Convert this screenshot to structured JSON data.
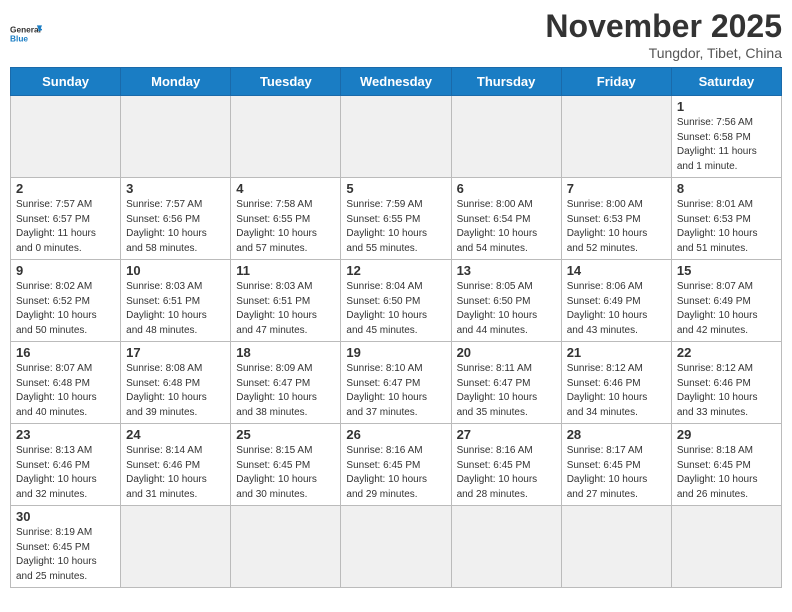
{
  "header": {
    "logo_general": "General",
    "logo_blue": "Blue",
    "month_year": "November 2025",
    "location": "Tungdor, Tibet, China"
  },
  "days_of_week": [
    "Sunday",
    "Monday",
    "Tuesday",
    "Wednesday",
    "Thursday",
    "Friday",
    "Saturday"
  ],
  "weeks": [
    {
      "days": [
        {
          "number": "",
          "empty": true
        },
        {
          "number": "",
          "empty": true
        },
        {
          "number": "",
          "empty": true
        },
        {
          "number": "",
          "empty": true
        },
        {
          "number": "",
          "empty": true
        },
        {
          "number": "",
          "empty": true
        },
        {
          "number": "1",
          "sunrise": "Sunrise: 7:56 AM",
          "sunset": "Sunset: 6:58 PM",
          "daylight": "Daylight: 11 hours and 1 minute."
        }
      ]
    },
    {
      "days": [
        {
          "number": "2",
          "sunrise": "Sunrise: 7:57 AM",
          "sunset": "Sunset: 6:57 PM",
          "daylight": "Daylight: 11 hours and 0 minutes."
        },
        {
          "number": "3",
          "sunrise": "Sunrise: 7:57 AM",
          "sunset": "Sunset: 6:56 PM",
          "daylight": "Daylight: 10 hours and 58 minutes."
        },
        {
          "number": "4",
          "sunrise": "Sunrise: 7:58 AM",
          "sunset": "Sunset: 6:55 PM",
          "daylight": "Daylight: 10 hours and 57 minutes."
        },
        {
          "number": "5",
          "sunrise": "Sunrise: 7:59 AM",
          "sunset": "Sunset: 6:55 PM",
          "daylight": "Daylight: 10 hours and 55 minutes."
        },
        {
          "number": "6",
          "sunrise": "Sunrise: 8:00 AM",
          "sunset": "Sunset: 6:54 PM",
          "daylight": "Daylight: 10 hours and 54 minutes."
        },
        {
          "number": "7",
          "sunrise": "Sunrise: 8:00 AM",
          "sunset": "Sunset: 6:53 PM",
          "daylight": "Daylight: 10 hours and 52 minutes."
        },
        {
          "number": "8",
          "sunrise": "Sunrise: 8:01 AM",
          "sunset": "Sunset: 6:53 PM",
          "daylight": "Daylight: 10 hours and 51 minutes."
        }
      ]
    },
    {
      "days": [
        {
          "number": "9",
          "sunrise": "Sunrise: 8:02 AM",
          "sunset": "Sunset: 6:52 PM",
          "daylight": "Daylight: 10 hours and 50 minutes."
        },
        {
          "number": "10",
          "sunrise": "Sunrise: 8:03 AM",
          "sunset": "Sunset: 6:51 PM",
          "daylight": "Daylight: 10 hours and 48 minutes."
        },
        {
          "number": "11",
          "sunrise": "Sunrise: 8:03 AM",
          "sunset": "Sunset: 6:51 PM",
          "daylight": "Daylight: 10 hours and 47 minutes."
        },
        {
          "number": "12",
          "sunrise": "Sunrise: 8:04 AM",
          "sunset": "Sunset: 6:50 PM",
          "daylight": "Daylight: 10 hours and 45 minutes."
        },
        {
          "number": "13",
          "sunrise": "Sunrise: 8:05 AM",
          "sunset": "Sunset: 6:50 PM",
          "daylight": "Daylight: 10 hours and 44 minutes."
        },
        {
          "number": "14",
          "sunrise": "Sunrise: 8:06 AM",
          "sunset": "Sunset: 6:49 PM",
          "daylight": "Daylight: 10 hours and 43 minutes."
        },
        {
          "number": "15",
          "sunrise": "Sunrise: 8:07 AM",
          "sunset": "Sunset: 6:49 PM",
          "daylight": "Daylight: 10 hours and 42 minutes."
        }
      ]
    },
    {
      "days": [
        {
          "number": "16",
          "sunrise": "Sunrise: 8:07 AM",
          "sunset": "Sunset: 6:48 PM",
          "daylight": "Daylight: 10 hours and 40 minutes."
        },
        {
          "number": "17",
          "sunrise": "Sunrise: 8:08 AM",
          "sunset": "Sunset: 6:48 PM",
          "daylight": "Daylight: 10 hours and 39 minutes."
        },
        {
          "number": "18",
          "sunrise": "Sunrise: 8:09 AM",
          "sunset": "Sunset: 6:47 PM",
          "daylight": "Daylight: 10 hours and 38 minutes."
        },
        {
          "number": "19",
          "sunrise": "Sunrise: 8:10 AM",
          "sunset": "Sunset: 6:47 PM",
          "daylight": "Daylight: 10 hours and 37 minutes."
        },
        {
          "number": "20",
          "sunrise": "Sunrise: 8:11 AM",
          "sunset": "Sunset: 6:47 PM",
          "daylight": "Daylight: 10 hours and 35 minutes."
        },
        {
          "number": "21",
          "sunrise": "Sunrise: 8:12 AM",
          "sunset": "Sunset: 6:46 PM",
          "daylight": "Daylight: 10 hours and 34 minutes."
        },
        {
          "number": "22",
          "sunrise": "Sunrise: 8:12 AM",
          "sunset": "Sunset: 6:46 PM",
          "daylight": "Daylight: 10 hours and 33 minutes."
        }
      ]
    },
    {
      "days": [
        {
          "number": "23",
          "sunrise": "Sunrise: 8:13 AM",
          "sunset": "Sunset: 6:46 PM",
          "daylight": "Daylight: 10 hours and 32 minutes."
        },
        {
          "number": "24",
          "sunrise": "Sunrise: 8:14 AM",
          "sunset": "Sunset: 6:46 PM",
          "daylight": "Daylight: 10 hours and 31 minutes."
        },
        {
          "number": "25",
          "sunrise": "Sunrise: 8:15 AM",
          "sunset": "Sunset: 6:45 PM",
          "daylight": "Daylight: 10 hours and 30 minutes."
        },
        {
          "number": "26",
          "sunrise": "Sunrise: 8:16 AM",
          "sunset": "Sunset: 6:45 PM",
          "daylight": "Daylight: 10 hours and 29 minutes."
        },
        {
          "number": "27",
          "sunrise": "Sunrise: 8:16 AM",
          "sunset": "Sunset: 6:45 PM",
          "daylight": "Daylight: 10 hours and 28 minutes."
        },
        {
          "number": "28",
          "sunrise": "Sunrise: 8:17 AM",
          "sunset": "Sunset: 6:45 PM",
          "daylight": "Daylight: 10 hours and 27 minutes."
        },
        {
          "number": "29",
          "sunrise": "Sunrise: 8:18 AM",
          "sunset": "Sunset: 6:45 PM",
          "daylight": "Daylight: 10 hours and 26 minutes."
        }
      ]
    },
    {
      "days": [
        {
          "number": "30",
          "sunrise": "Sunrise: 8:19 AM",
          "sunset": "Sunset: 6:45 PM",
          "daylight": "Daylight: 10 hours and 25 minutes."
        },
        {
          "number": "",
          "empty": true
        },
        {
          "number": "",
          "empty": true
        },
        {
          "number": "",
          "empty": true
        },
        {
          "number": "",
          "empty": true
        },
        {
          "number": "",
          "empty": true
        },
        {
          "number": "",
          "empty": true
        }
      ]
    }
  ]
}
